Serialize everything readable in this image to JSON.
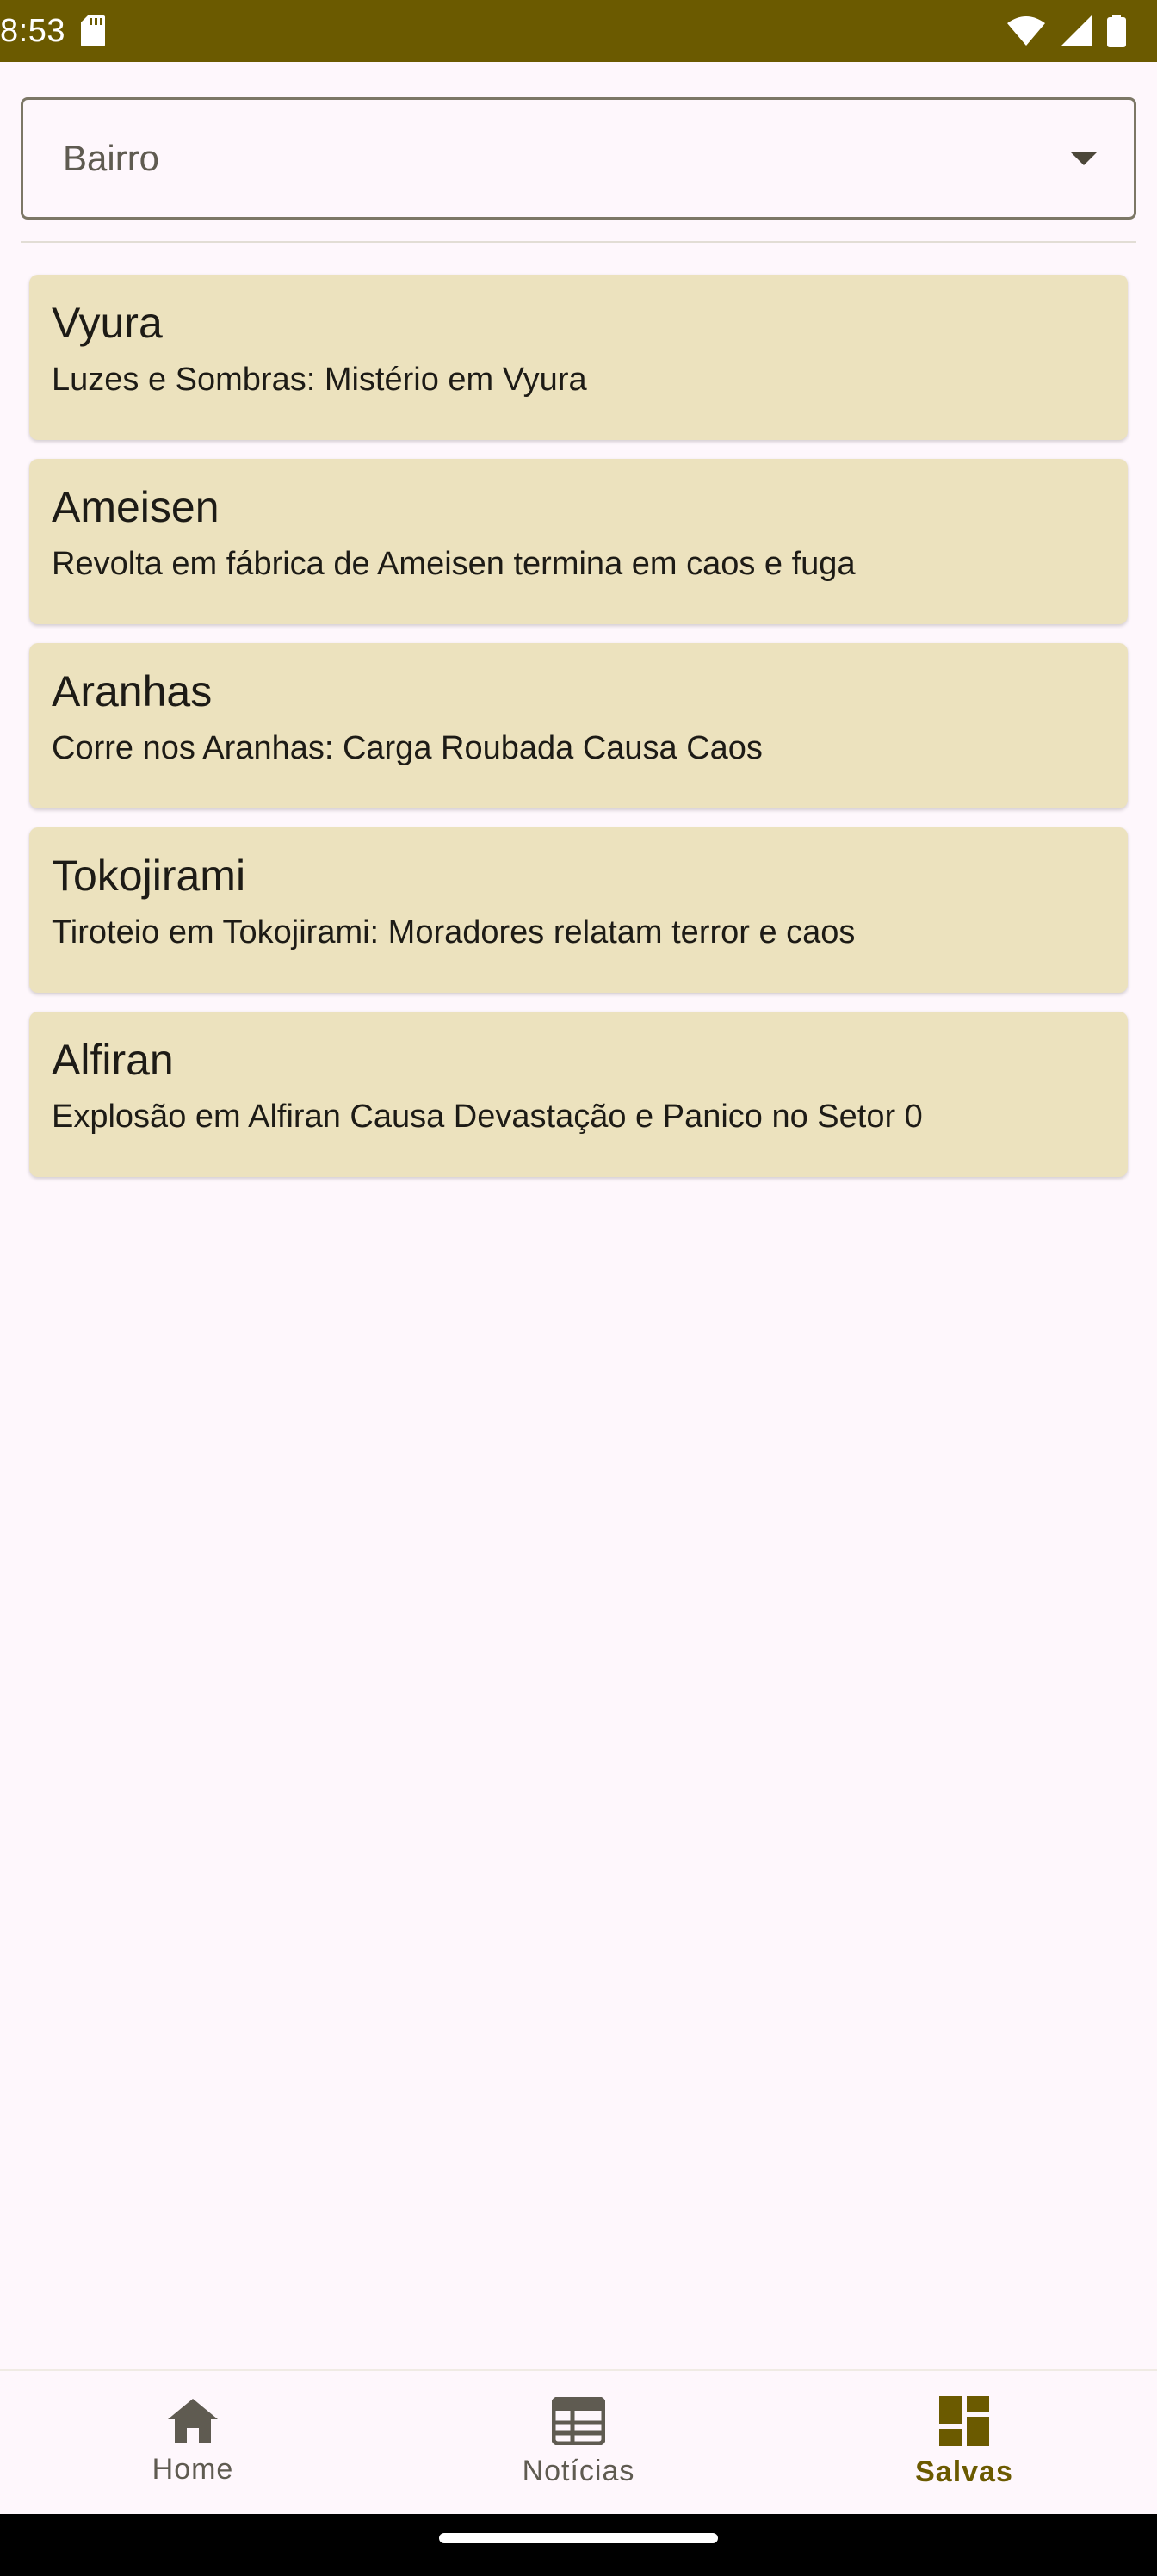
{
  "status_bar": {
    "time": "8:53",
    "icons": [
      "sd-card-icon",
      "wifi-icon",
      "signal-icon",
      "battery-icon"
    ]
  },
  "filter": {
    "placeholder": "Bairro"
  },
  "news_items": [
    {
      "title": "Vyura",
      "subtitle": "Luzes e Sombras: Mistério em Vyura"
    },
    {
      "title": "Ameisen",
      "subtitle": "Revolta em fábrica de Ameisen termina em caos e fuga"
    },
    {
      "title": "Aranhas",
      "subtitle": "Corre nos Aranhas: Carga Roubada Causa Caos"
    },
    {
      "title": "Tokojirami",
      "subtitle": "Tiroteio em Tokojirami: Moradores relatam terror e caos"
    },
    {
      "title": "Alfiran",
      "subtitle": "Explosão em Alfiran Causa Devastação e Panico no Setor 0"
    }
  ],
  "bottom_nav": {
    "items": [
      {
        "label": "Home",
        "icon": "home-icon",
        "active": false
      },
      {
        "label": "Notícias",
        "icon": "newspaper-icon",
        "active": false
      },
      {
        "label": "Salvas",
        "icon": "dashboard-icon",
        "active": true
      }
    ]
  },
  "colors": {
    "status_bar": "#6b5a00",
    "card_background": "#ece2be",
    "page_background": "#fef7fc",
    "active_nav": "#6b5a00"
  }
}
